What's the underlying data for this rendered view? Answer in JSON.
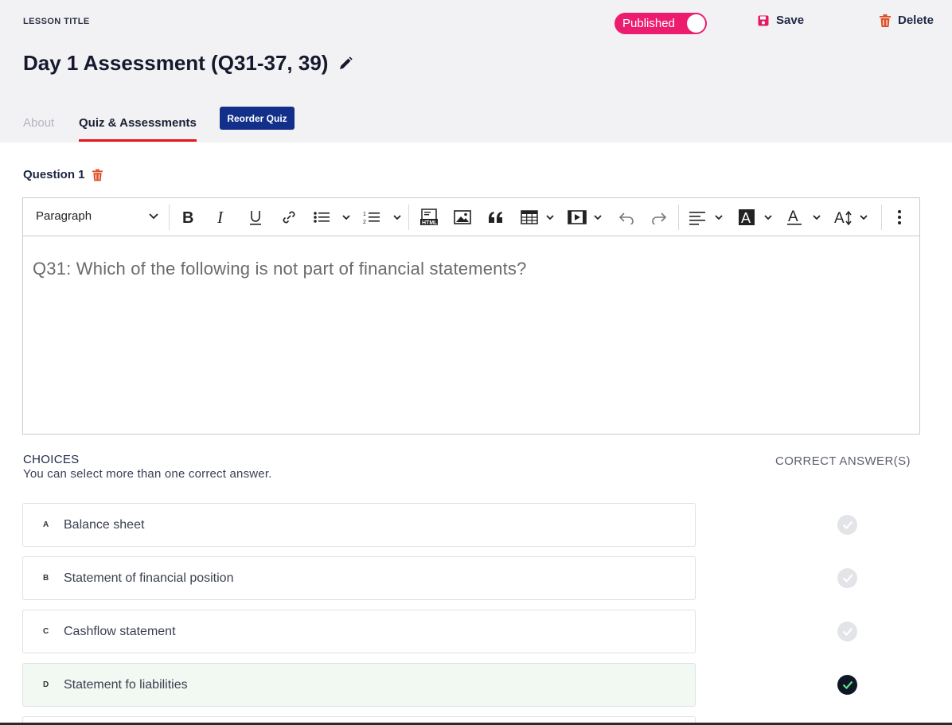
{
  "header": {
    "lesson_label": "LESSON TITLE",
    "lesson_title": "Day 1 Assessment (Q31-37, 39)",
    "publish_label": "Published",
    "save_label": "Save",
    "delete_label": "Delete"
  },
  "tabs": {
    "about": "About",
    "quiz": "Quiz & Assessments",
    "reorder": "Reorder Quiz"
  },
  "question": {
    "label": "Question 1",
    "format": "Paragraph",
    "text": "Q31: Which of the following is not part of financial statements?"
  },
  "choices": {
    "label": "CHOICES",
    "hint": "You can select more than one correct answer.",
    "correct_label": "CORRECT ANSWER(S)",
    "items": [
      {
        "letter": "A",
        "text": "Balance sheet",
        "correct": false
      },
      {
        "letter": "B",
        "text": "Statement of financial position",
        "correct": false
      },
      {
        "letter": "C",
        "text": "Cashflow statement",
        "correct": false
      },
      {
        "letter": "D",
        "text": "Statement fo liabilities",
        "correct": true
      }
    ]
  },
  "colors": {
    "accent_pink": "#ec1d6f",
    "primary_navy": "#12308a",
    "tab_underline": "#e8141c",
    "trash_orange": "#e0502a"
  }
}
